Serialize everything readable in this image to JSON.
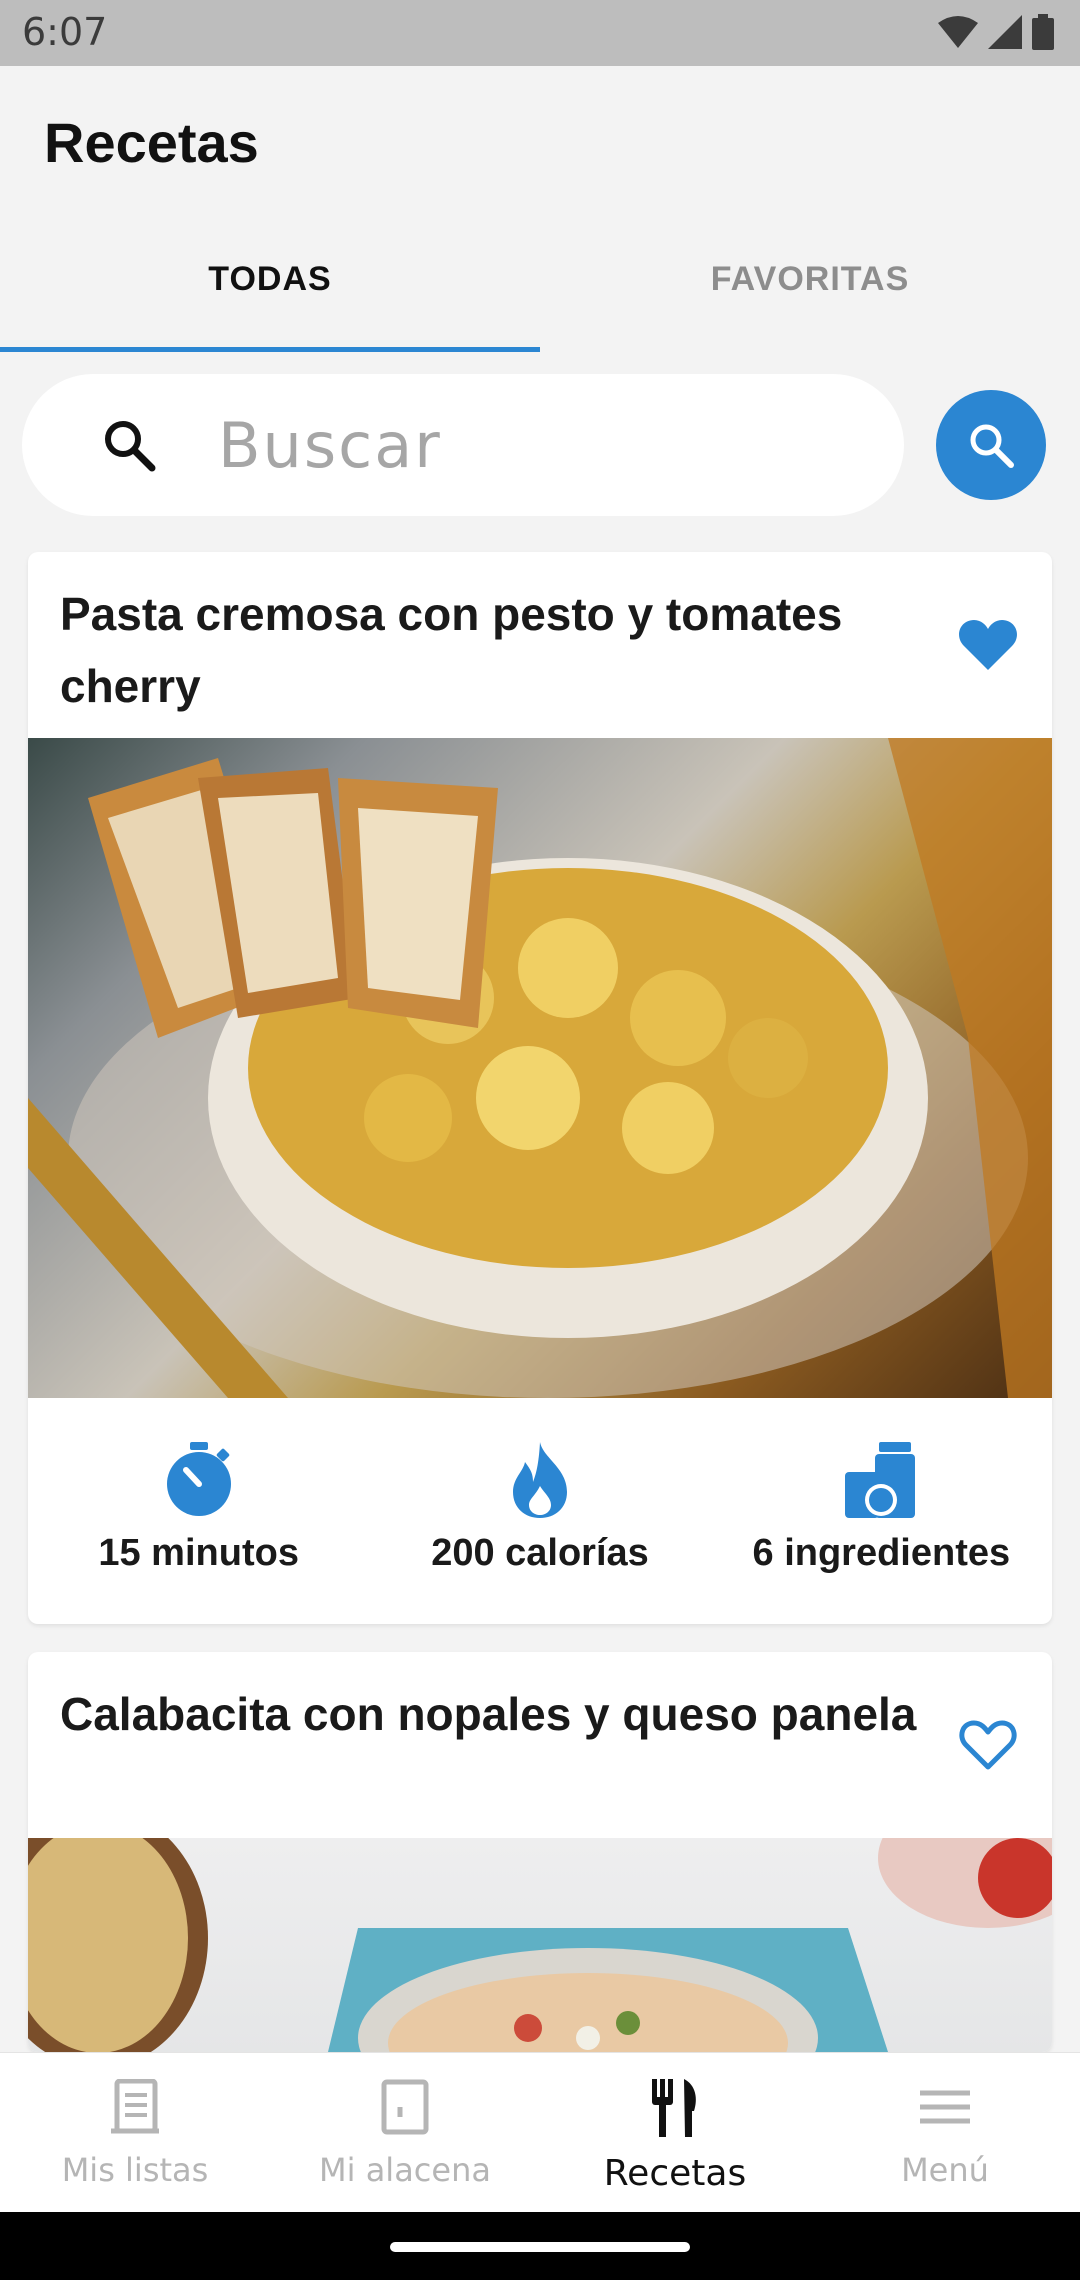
{
  "status_bar": {
    "time": "6:07"
  },
  "app_bar": {
    "title": "Recetas"
  },
  "tabs": [
    {
      "label": "TODAS",
      "active": true
    },
    {
      "label": "FAVORITAS",
      "active": false
    }
  ],
  "search": {
    "placeholder": "Buscar",
    "value": ""
  },
  "recipes": [
    {
      "title": "Pasta cremosa con pesto y tomates cherry",
      "favorite": true,
      "stats": {
        "time": "15 minutos",
        "calories": "200 calorías",
        "ingredients": "6 ingredientes"
      }
    },
    {
      "title": "Calabacita con nopales y queso panela",
      "favorite": false
    }
  ],
  "bottom_nav": [
    {
      "label": "Mis listas",
      "icon": "list-icon",
      "active": false
    },
    {
      "label": "Mi alacena",
      "icon": "pantry-icon",
      "active": false
    },
    {
      "label": "Recetas",
      "icon": "fork-knife-icon",
      "active": true
    },
    {
      "label": "Menú",
      "icon": "menu-icon",
      "active": false
    }
  ],
  "colors": {
    "accent": "#2b86d2",
    "inactive": "#b5b5b5"
  }
}
